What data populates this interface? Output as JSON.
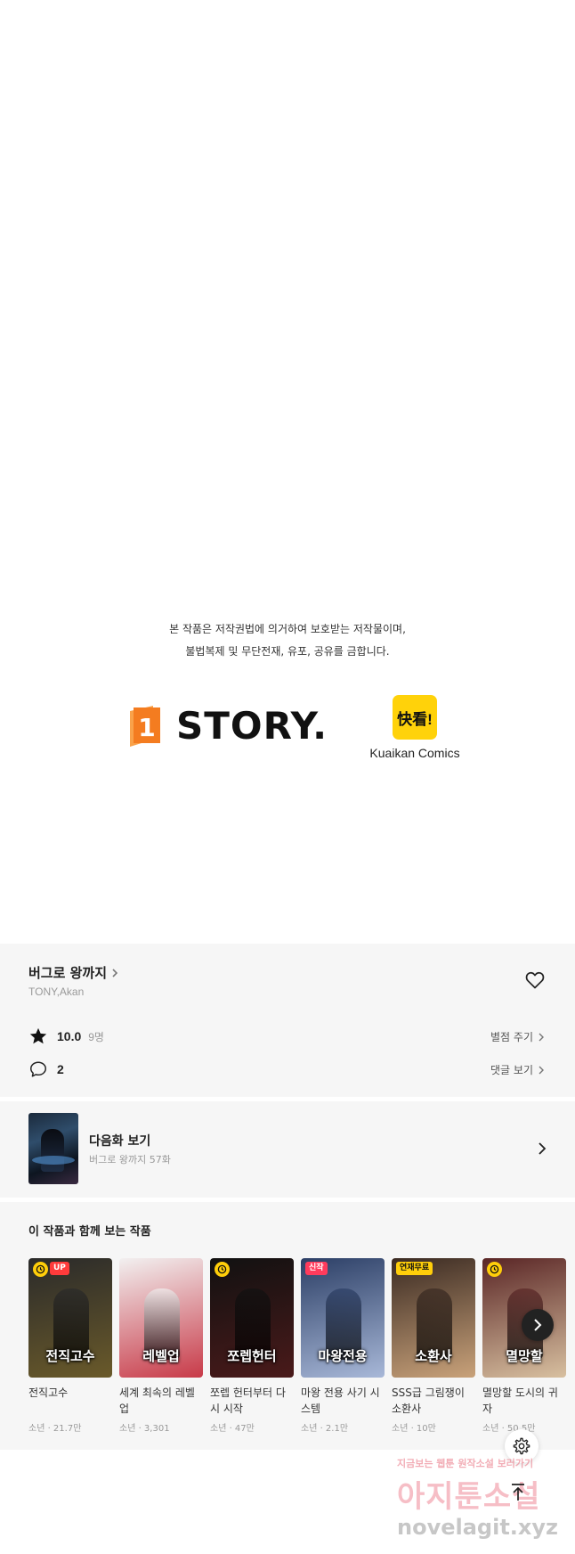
{
  "copyright": {
    "line1": "본 작품은 저작권법에 의거하여 보호받는 저작물이며,",
    "line2": "불법복제 및 무단전재, 유포, 공유를 금합니다."
  },
  "logos": {
    "story_number": "1",
    "story_text": "STORY.",
    "kuaikan_mark": "快看!",
    "kuaikan_text": "Kuaikan Comics"
  },
  "work": {
    "title": "버그로 왕까지",
    "author": "TONY,Akan",
    "rating": "10.0",
    "rating_count": "9명",
    "rate_label": "별점 주기",
    "comment_count": "2",
    "comment_label": "댓글 보기"
  },
  "next_episode": {
    "label": "다음화 보기",
    "subtitle": "버그로 왕까지 57화"
  },
  "recommend": {
    "heading": "이 작품과 함께 보는 작품",
    "items": [
      {
        "name": "전직고수",
        "meta": "소년 · 21.7만",
        "cover_text": "전직고수",
        "badge": "UP",
        "badge_color": "#ff3b3b",
        "clock": true,
        "colors": [
          "#2a2a2a",
          "#6a5a2a"
        ]
      },
      {
        "name": "세계 최속의 레벨업",
        "meta": "소년 · 3,301",
        "cover_text": "레벨업",
        "badge": "",
        "badge_color": "",
        "clock": false,
        "colors": [
          "#f2f0f0",
          "#c83a48"
        ]
      },
      {
        "name": "쪼렙 헌터부터 다시 시작",
        "meta": "소년 · 47만",
        "cover_text": "쪼렙헌터",
        "badge": "",
        "badge_color": "",
        "clock": true,
        "colors": [
          "#111111",
          "#4a1a1a"
        ]
      },
      {
        "name": "마왕 전용 사기 시스템",
        "meta": "소년 · 2.1만",
        "cover_text": "마왕전용",
        "badge": "신작",
        "badge_color": "#ff3b5c",
        "clock": false,
        "colors": [
          "#2c3f66",
          "#a8b8d8"
        ]
      },
      {
        "name": "SSS급 그림쟁이 소환사",
        "meta": "소년 · 10만",
        "cover_text": "소환사",
        "badge": "연재무료",
        "badge_color": "#ffce0a",
        "clock": false,
        "colors": [
          "#3a2a22",
          "#c9a27a"
        ]
      },
      {
        "name": "멸망할 도시의 귀자",
        "meta": "소년 · 50.5만",
        "cover_text": "멸망할",
        "badge": "",
        "badge_color": "",
        "clock": true,
        "colors": [
          "#5a2626",
          "#d8c0a0"
        ]
      }
    ]
  },
  "watermark": {
    "top": "지금보는 웹툰 원작소설 보러가기",
    "main": "아지툰소설",
    "url": "novelagit.xyz"
  },
  "colors": {
    "panel_bg": "#f6f6f6",
    "kuaikan_yellow": "#ffd20a",
    "story_orange": "#f47c20"
  }
}
